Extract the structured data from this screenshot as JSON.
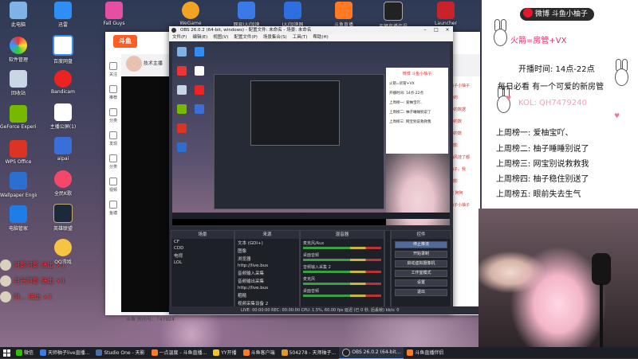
{
  "desktop": {
    "icons_col1": [
      "此电脑",
      "软件管理",
      "回收站",
      "GeForce Experience",
      "WPS Office",
      "Wallpaper Engine: 壁纸引擎",
      "电脑管家"
    ],
    "icons_col2": [
      "迅雷",
      "百度网盘",
      "Bandicam",
      "主播公屏(1)",
      "aipai",
      "全民K歌",
      "英雄联盟",
      "QQ游戏"
    ],
    "icons_top": [
      "Fall Guys",
      "WeGame",
      "网易UU加速",
      "UU加速器",
      "斗鱼直播",
      "天狮直播伴侣",
      "Launcher"
    ]
  },
  "browser": {
    "logo": "斗鱼",
    "anchor_name": "技术主播",
    "room_label": "斗鱼 房间号：747924",
    "side_items": [
      "关注",
      "推荐",
      "分类",
      "发现",
      "分类",
      "视频",
      "鱼塘"
    ],
    "right_msgs": [
      "柚子小柚子",
      "中的",
      "中的数据",
      "中的数",
      "中的数",
      "阿影",
      "海风挂了都",
      "柚子，我",
      "阿影",
      "我 阿阿",
      "柚子小柚子"
    ]
  },
  "obs": {
    "title": "OBS 26.0.2 (64-bit, windows) - 配置文件: 未命名 - 场景: 未命名",
    "menu": [
      "文件(F)",
      "编辑(E)",
      "视图(V)",
      "配置文件(P)",
      "场景集合(S)",
      "工具(T)",
      "帮助(H)"
    ],
    "docks": {
      "scenes_title": "场景",
      "scenes": [
        "CF",
        "CDD",
        "电视",
        "LOL"
      ],
      "sources_title": "来源",
      "sources": [
        "文本 (GDI+)",
        "图像",
        "浏览器",
        "http://live.bus",
        "音频输入采集",
        "音频输出采集",
        "http://live.bus",
        "粗糙",
        "视频采集设备 2",
        "视频",
        "显示器采集"
      ],
      "mixer_title": "混音器",
      "mixer": [
        "麦克风/Aux",
        "桌面音频",
        "音频输入采集 2",
        "麦克风",
        "桌面音频"
      ],
      "transitions_title": "转场",
      "controls_title": "控件",
      "controls": [
        "停止推流",
        "开始录制",
        "启动虚拟摄像机",
        "工作室模式",
        "设置",
        "退出"
      ]
    },
    "status": "LIVE: 00:00:00   REC: 00:00:00   CPU: 1.5%, 60.00 fps   延迟 (已 0 秒, 后丢帧)   kb/s: 0"
  },
  "overlay": {
    "weibo": "微博 斗鱼小柚子",
    "handle": "火箭=房管+VX",
    "time": "开播时间: 14点-22点",
    "tagline": "每日必看 有一个可爱的新房管",
    "kol": "KOL: QH7479240",
    "users": [
      "上周榜一: 爱柚宝吖、",
      "上周榜二: 柚子睡睡别说了",
      "上周榜三: 网宝别说救救我",
      "上周榜四: 柚子稳住别送了",
      "上周榜五: 眼前失去生气"
    ]
  },
  "gifts": [
    "×1",
    "×1",
    "×1"
  ],
  "gift_names": [
    "阿影阿影 送出 ",
    "月光阿影 送出 ",
    "阿... 送出 "
  ],
  "taskbar": {
    "items": [
      "微信",
      "天师柚子live直播...",
      "Studio One - 天影",
      "一点温度 - 斗鱼直播...",
      "YY开播",
      "斗鱼客户端",
      "504278 - 天师柚子...",
      "OBS 26.0.2 (64-bit...",
      "斗鱼直播伴侣"
    ]
  },
  "colors": {
    "obs_bg": "#2b2e38",
    "accent_pink": "#e1306c",
    "weibo_red": "#e6162d"
  }
}
